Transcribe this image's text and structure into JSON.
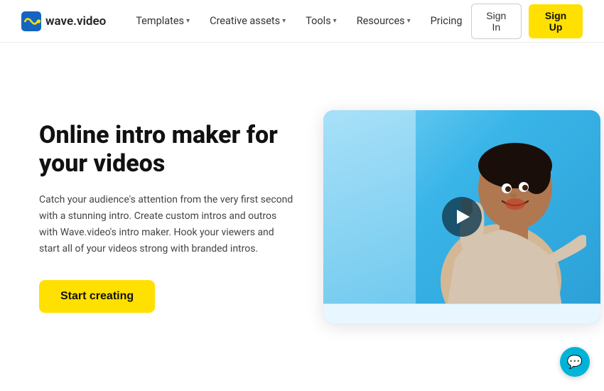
{
  "brand": {
    "name": "wave.video",
    "logo_alt": "wave.video logo"
  },
  "navbar": {
    "links": [
      {
        "label": "Templates",
        "has_dropdown": true
      },
      {
        "label": "Creative assets",
        "has_dropdown": true
      },
      {
        "label": "Tools",
        "has_dropdown": true
      },
      {
        "label": "Resources",
        "has_dropdown": true
      },
      {
        "label": "Pricing",
        "has_dropdown": false
      }
    ],
    "signin_label": "Sign In",
    "signup_label": "Sign Up"
  },
  "hero": {
    "title": "Online intro maker for your videos",
    "description": "Catch your audience's attention from the very first second with a stunning intro. Create custom intros and outros with Wave.video's intro maker. Hook your viewers and start all of your videos strong with branded intros.",
    "cta_label": "Start creating"
  }
}
